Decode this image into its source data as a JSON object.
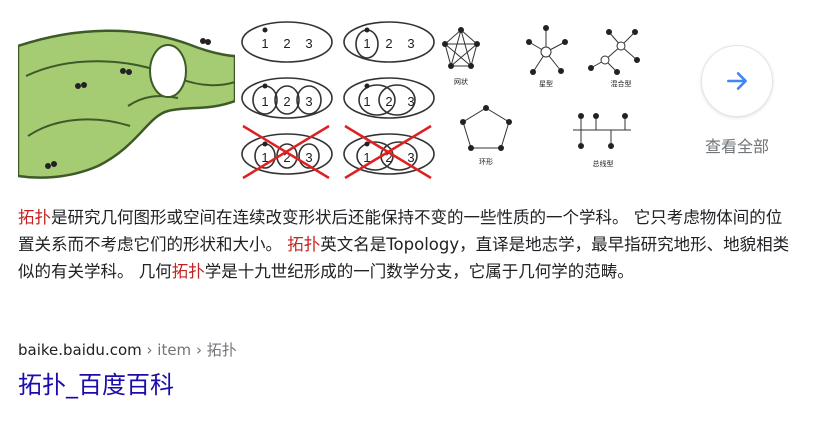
{
  "images": [
    {
      "name": "mobius-strip-with-ants",
      "label": ""
    },
    {
      "name": "venn-circles-1",
      "label": ""
    },
    {
      "name": "venn-circles-2",
      "label": ""
    },
    {
      "name": "network-topologies",
      "labels": [
        "网状",
        "星型",
        "混合型",
        "环形",
        "总线型"
      ]
    }
  ],
  "circle_numbers": [
    "1",
    "2",
    "3"
  ],
  "more": {
    "label": "查看全部",
    "icon": "arrow-right-icon",
    "accent": "#4285f4"
  },
  "snippet": {
    "s1": "拓扑",
    "s2": "是研究几何图形或空间在连续改变形状后还能保持不变的一些性质的一个学科。 它只考虑物体间的位置关系而不考虑它们的形状和大小。 ",
    "s3": "拓扑",
    "s4": "英文名是Topology，直译是地志学，最早指研究地形、地貌相类似的有关学科。 几何",
    "s5": "拓扑",
    "s6": "学是十九世纪形成的一门数学分支，它属于几何学的范畴。"
  },
  "breadcrumb": {
    "domain": "baike.baidu.com",
    "path": " › item › 拓扑"
  },
  "result": {
    "title": "拓扑_百度百科"
  },
  "colors": {
    "highlight": "#c5221f",
    "link": "#1a0dab",
    "gray": "#70757a",
    "cross": "#e02020"
  }
}
